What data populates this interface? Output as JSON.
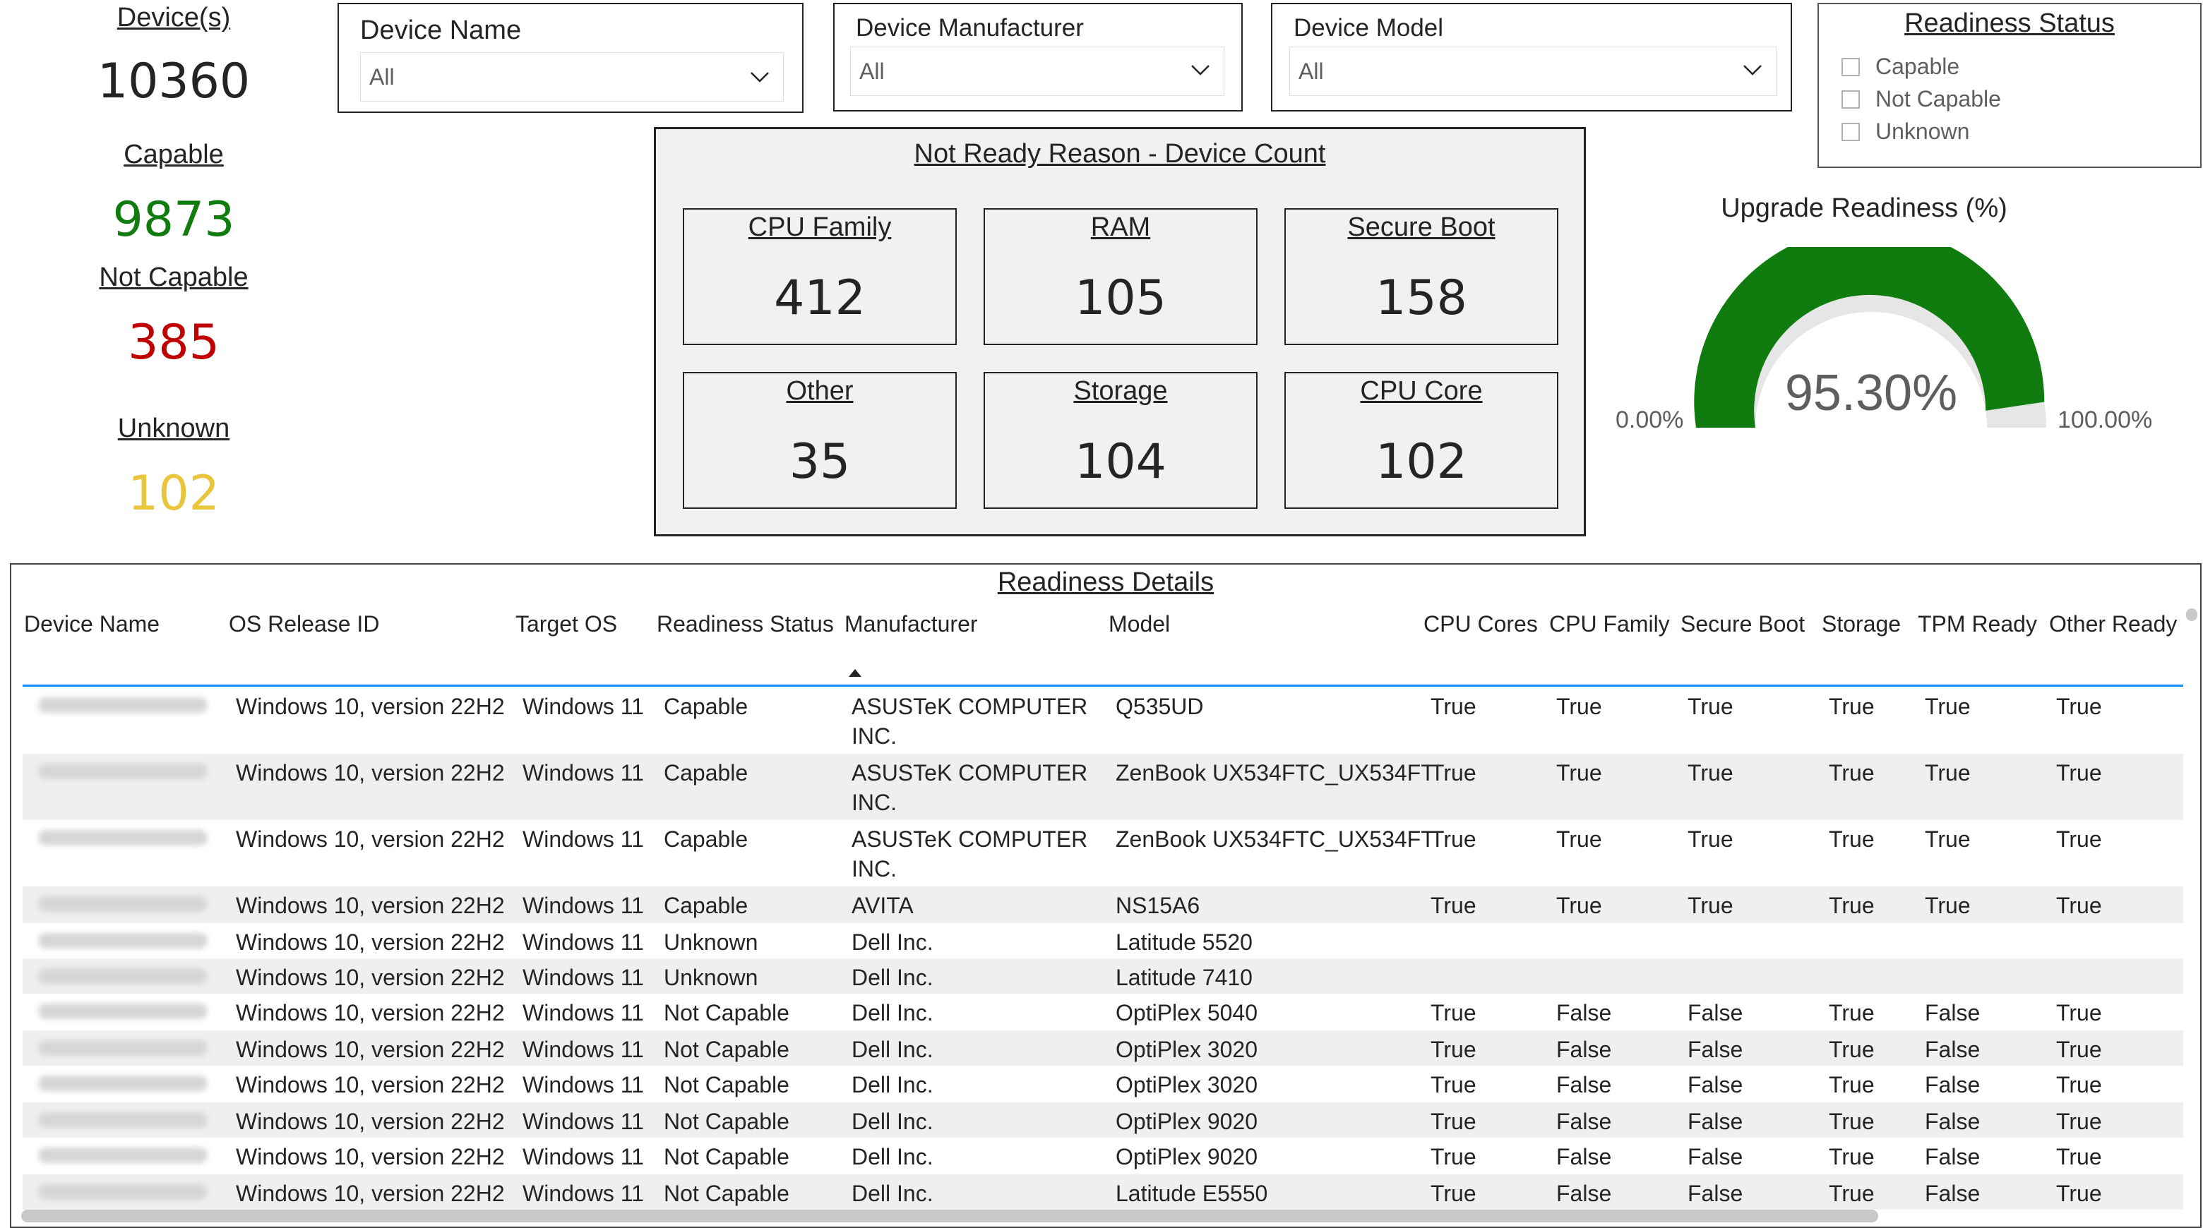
{
  "kpis": {
    "devices": {
      "label": "Device(s)",
      "value": "10360",
      "color": "#252423"
    },
    "capable": {
      "label": "Capable",
      "value": "9873",
      "color": "#107c10"
    },
    "not_capable": {
      "label": "Not Capable",
      "value": "385",
      "color": "#c00000"
    },
    "unknown": {
      "label": "Unknown",
      "value": "102",
      "color": "#e8c53a"
    }
  },
  "slicers": {
    "device_name": {
      "title": "Device Name",
      "value": "All"
    },
    "device_manufacturer": {
      "title": "Device Manufacturer",
      "value": "All"
    },
    "device_model": {
      "title": "Device Model",
      "value": "All"
    }
  },
  "readiness_status": {
    "title": "Readiness Status",
    "options": [
      "Capable",
      "Not Capable",
      "Unknown"
    ]
  },
  "not_ready": {
    "title": "Not Ready Reason - Device Count",
    "cards": [
      {
        "label": "CPU Family",
        "value": "412"
      },
      {
        "label": "RAM",
        "value": "105"
      },
      {
        "label": "Secure Boot",
        "value": "158"
      },
      {
        "label": "Other",
        "value": "35"
      },
      {
        "label": "Storage",
        "value": "104"
      },
      {
        "label": "CPU Core",
        "value": "102"
      }
    ]
  },
  "gauge": {
    "title": "Upgrade Readiness (%)",
    "value_label": "95.30%",
    "value": 0.953,
    "min_label": "0.00%",
    "max_label": "100.00%",
    "fill_color": "#107c10",
    "track_color": "#e6e6e6"
  },
  "table": {
    "title": "Readiness Details",
    "columns": [
      "Device Name",
      "OS Release ID",
      "Target OS",
      "Readiness Status",
      "Manufacturer",
      "Model",
      "CPU Cores",
      "CPU Family",
      "Secure Boot",
      "Storage",
      "TPM Ready",
      "Other Ready"
    ],
    "rows": [
      {
        "os": "Windows 10, version 22H2",
        "target": "Windows 11",
        "status": "Capable",
        "mfr": "ASUSTeK COMPUTER",
        "mfr2": "INC.",
        "model": "Q535UD",
        "cores": "True",
        "family": "True",
        "secure": "True",
        "storage": "True",
        "tpm": "True",
        "other": "True"
      },
      {
        "os": "Windows 10, version 22H2",
        "target": "Windows 11",
        "status": "Capable",
        "mfr": "ASUSTeK COMPUTER",
        "mfr2": "INC.",
        "model": "ZenBook UX534FTC_UX534FT",
        "cores": "True",
        "family": "True",
        "secure": "True",
        "storage": "True",
        "tpm": "True",
        "other": "True"
      },
      {
        "os": "Windows 10, version 22H2",
        "target": "Windows 11",
        "status": "Capable",
        "mfr": "ASUSTeK COMPUTER",
        "mfr2": "INC.",
        "model": "ZenBook UX534FTC_UX534FT",
        "cores": "True",
        "family": "True",
        "secure": "True",
        "storage": "True",
        "tpm": "True",
        "other": "True"
      },
      {
        "os": "Windows 10, version 22H2",
        "target": "Windows 11",
        "status": "Capable",
        "mfr": "AVITA",
        "mfr2": "",
        "model": "NS15A6",
        "cores": "True",
        "family": "True",
        "secure": "True",
        "storage": "True",
        "tpm": "True",
        "other": "True"
      },
      {
        "os": "Windows 10, version 22H2",
        "target": "Windows 11",
        "status": "Unknown",
        "mfr": "Dell Inc.",
        "mfr2": "",
        "model": "Latitude 5520",
        "cores": "",
        "family": "",
        "secure": "",
        "storage": "",
        "tpm": "",
        "other": ""
      },
      {
        "os": "Windows 10, version 22H2",
        "target": "Windows 11",
        "status": "Unknown",
        "mfr": "Dell Inc.",
        "mfr2": "",
        "model": "Latitude 7410",
        "cores": "",
        "family": "",
        "secure": "",
        "storage": "",
        "tpm": "",
        "other": ""
      },
      {
        "os": "Windows 10, version 22H2",
        "target": "Windows 11",
        "status": "Not Capable",
        "mfr": "Dell Inc.",
        "mfr2": "",
        "model": "OptiPlex 5040",
        "cores": "True",
        "family": "False",
        "secure": "False",
        "storage": "True",
        "tpm": "False",
        "other": "True"
      },
      {
        "os": "Windows 10, version 22H2",
        "target": "Windows 11",
        "status": "Not Capable",
        "mfr": "Dell Inc.",
        "mfr2": "",
        "model": "OptiPlex 3020",
        "cores": "True",
        "family": "False",
        "secure": "False",
        "storage": "True",
        "tpm": "False",
        "other": "True"
      },
      {
        "os": "Windows 10, version 22H2",
        "target": "Windows 11",
        "status": "Not Capable",
        "mfr": "Dell Inc.",
        "mfr2": "",
        "model": "OptiPlex 3020",
        "cores": "True",
        "family": "False",
        "secure": "False",
        "storage": "True",
        "tpm": "False",
        "other": "True"
      },
      {
        "os": "Windows 10, version 22H2",
        "target": "Windows 11",
        "status": "Not Capable",
        "mfr": "Dell Inc.",
        "mfr2": "",
        "model": "OptiPlex 9020",
        "cores": "True",
        "family": "False",
        "secure": "False",
        "storage": "True",
        "tpm": "False",
        "other": "True"
      },
      {
        "os": "Windows 10, version 22H2",
        "target": "Windows 11",
        "status": "Not Capable",
        "mfr": "Dell Inc.",
        "mfr2": "",
        "model": "OptiPlex 9020",
        "cores": "True",
        "family": "False",
        "secure": "False",
        "storage": "True",
        "tpm": "False",
        "other": "True"
      },
      {
        "os": "Windows 10, version 22H2",
        "target": "Windows 11",
        "status": "Not Capable",
        "mfr": "Dell Inc.",
        "mfr2": "",
        "model": "Latitude E5550",
        "cores": "True",
        "family": "False",
        "secure": "False",
        "storage": "True",
        "tpm": "False",
        "other": "True"
      }
    ]
  }
}
